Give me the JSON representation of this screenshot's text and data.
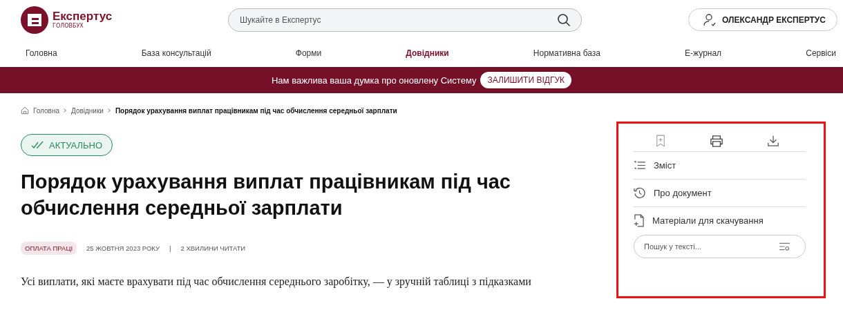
{
  "logo": {
    "name": "Експертус",
    "subtitle": "ГОЛОВБУХ"
  },
  "search": {
    "placeholder": "Шукайте в Експертус"
  },
  "user": {
    "name": "ОЛЕКСАНДР ЕКСПЕРТУС"
  },
  "nav": [
    {
      "label": "Головна",
      "selected": false
    },
    {
      "label": "База консультацій",
      "selected": false
    },
    {
      "label": "Форми",
      "selected": false
    },
    {
      "label": "Довідники",
      "selected": true
    },
    {
      "label": "Нормативна база",
      "selected": false
    },
    {
      "label": "Е-журнал",
      "selected": false
    },
    {
      "label": "Сервіси",
      "selected": false
    }
  ],
  "banner": {
    "text": "Нам важлива ваша думка про оновлену Систему",
    "button": "ЗАЛИШИТИ ВІДГУК"
  },
  "breadcrumbs": [
    {
      "label": "Головна"
    },
    {
      "label": "Довідники"
    },
    {
      "label": "Порядок урахування виплат працівникам під час обчислення середньої зарплати"
    }
  ],
  "status": "АКТУАЛЬНО",
  "title": "Порядок урахування виплат працівникам під час обчислення середньої зарплати",
  "meta": {
    "tag": "ОПЛАТА ПРАЦІ",
    "date": "25 ЖОВТНЯ 2023 РОКУ",
    "separator": "|",
    "read_time": "2 ХВИЛИНИ ЧИТАТИ"
  },
  "lead": "Усі виплати, які маєте врахувати під час обчислення середнього заробітку, — у зручній таблиці з підказками",
  "panel": {
    "menu": [
      {
        "kind": "contents",
        "label": "Зміст"
      },
      {
        "kind": "about",
        "label": "Про документ"
      },
      {
        "kind": "materials",
        "label": "Матеріали для скачування"
      }
    ],
    "search_placeholder": "Пошук у тексті..."
  }
}
